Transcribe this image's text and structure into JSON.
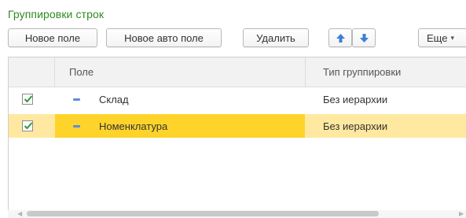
{
  "panel": {
    "title": "Группировки строк"
  },
  "toolbar": {
    "new_field": "Новое поле",
    "new_auto_field": "Новое авто поле",
    "delete": "Удалить",
    "more": "Еще",
    "move_up_icon": "arrow-up-icon",
    "move_down_icon": "arrow-down-icon"
  },
  "table": {
    "columns": [
      "Поле",
      "Тип группировки"
    ],
    "rows": [
      {
        "checked": true,
        "field": "Склад",
        "grouping_type": "Без иерархии",
        "selected": false
      },
      {
        "checked": true,
        "field": "Номенклатура",
        "grouping_type": "Без иерархии",
        "selected": true
      }
    ]
  },
  "colors": {
    "title": "#2e8b1f",
    "selected_row": "#ffe8a0",
    "selected_cell": "#ffd42a",
    "checkmark": "#2e9a3a",
    "arrow_icon": "#3d7fd9"
  }
}
